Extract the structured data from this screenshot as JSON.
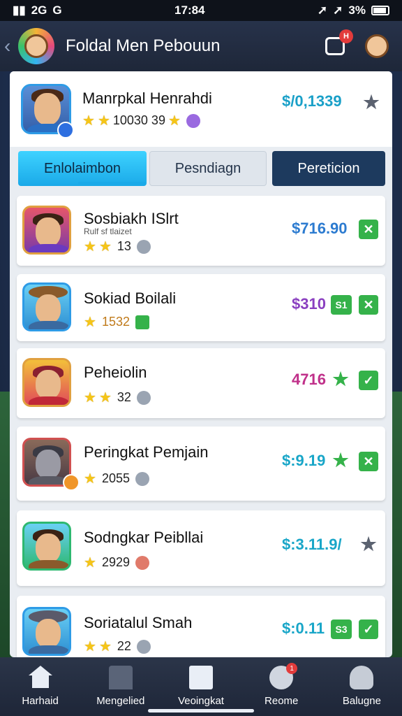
{
  "status_bar": {
    "network": "2G",
    "carrier_glyph": "G",
    "time": "17:84",
    "battery": "3%"
  },
  "header": {
    "title": "Foldal Men Pebouun",
    "shop_badge": "H"
  },
  "me": {
    "name": "Manrpkal Henrahdi",
    "score": "10030 39",
    "price": "$/0,1339",
    "action": "star-icon"
  },
  "tabs": [
    {
      "label": "Enlolaimbon"
    },
    {
      "label": "Pesndiagn"
    },
    {
      "label": "Pereticion"
    }
  ],
  "rows": [
    {
      "name": "Sosbiakh ISlrt",
      "sub": "Rulf sf tlaizet",
      "score": "13",
      "price": "$716.90",
      "price_color": "#2c7bd0",
      "action": "close-icon"
    },
    {
      "name": "Sokiad Boilali",
      "sub": "",
      "score": "1532",
      "price": "$310",
      "price_badge": "S1",
      "price_color": "#8a3fc0",
      "action": "close-icon"
    },
    {
      "name": "Peheiolin",
      "sub": "",
      "score": "32",
      "price": "4716",
      "price_color": "#c0308a",
      "action": "check-icon"
    },
    {
      "name": "Peringkat Pemjain",
      "sub": "",
      "score": "2055",
      "price": "$:9.19",
      "price_color": "#19a6c8",
      "action": "close-icon"
    },
    {
      "name": "Sodngkar Peibllai",
      "sub": "",
      "score": "2929",
      "price": "$:3.11.9/",
      "price_color": "#19a6c8",
      "action": "star-icon"
    },
    {
      "name": "Soriatalul Smah",
      "sub": "",
      "score": "22",
      "price": "$:0.11",
      "price_badge": "S3",
      "price_color": "#19a6c8",
      "action": "check-icon"
    }
  ],
  "nav": [
    {
      "label": "Harhaid"
    },
    {
      "label": "Mengelied"
    },
    {
      "label": "Veoingkat"
    },
    {
      "label": "Reome",
      "badge": "1"
    },
    {
      "label": "Balugne"
    }
  ]
}
